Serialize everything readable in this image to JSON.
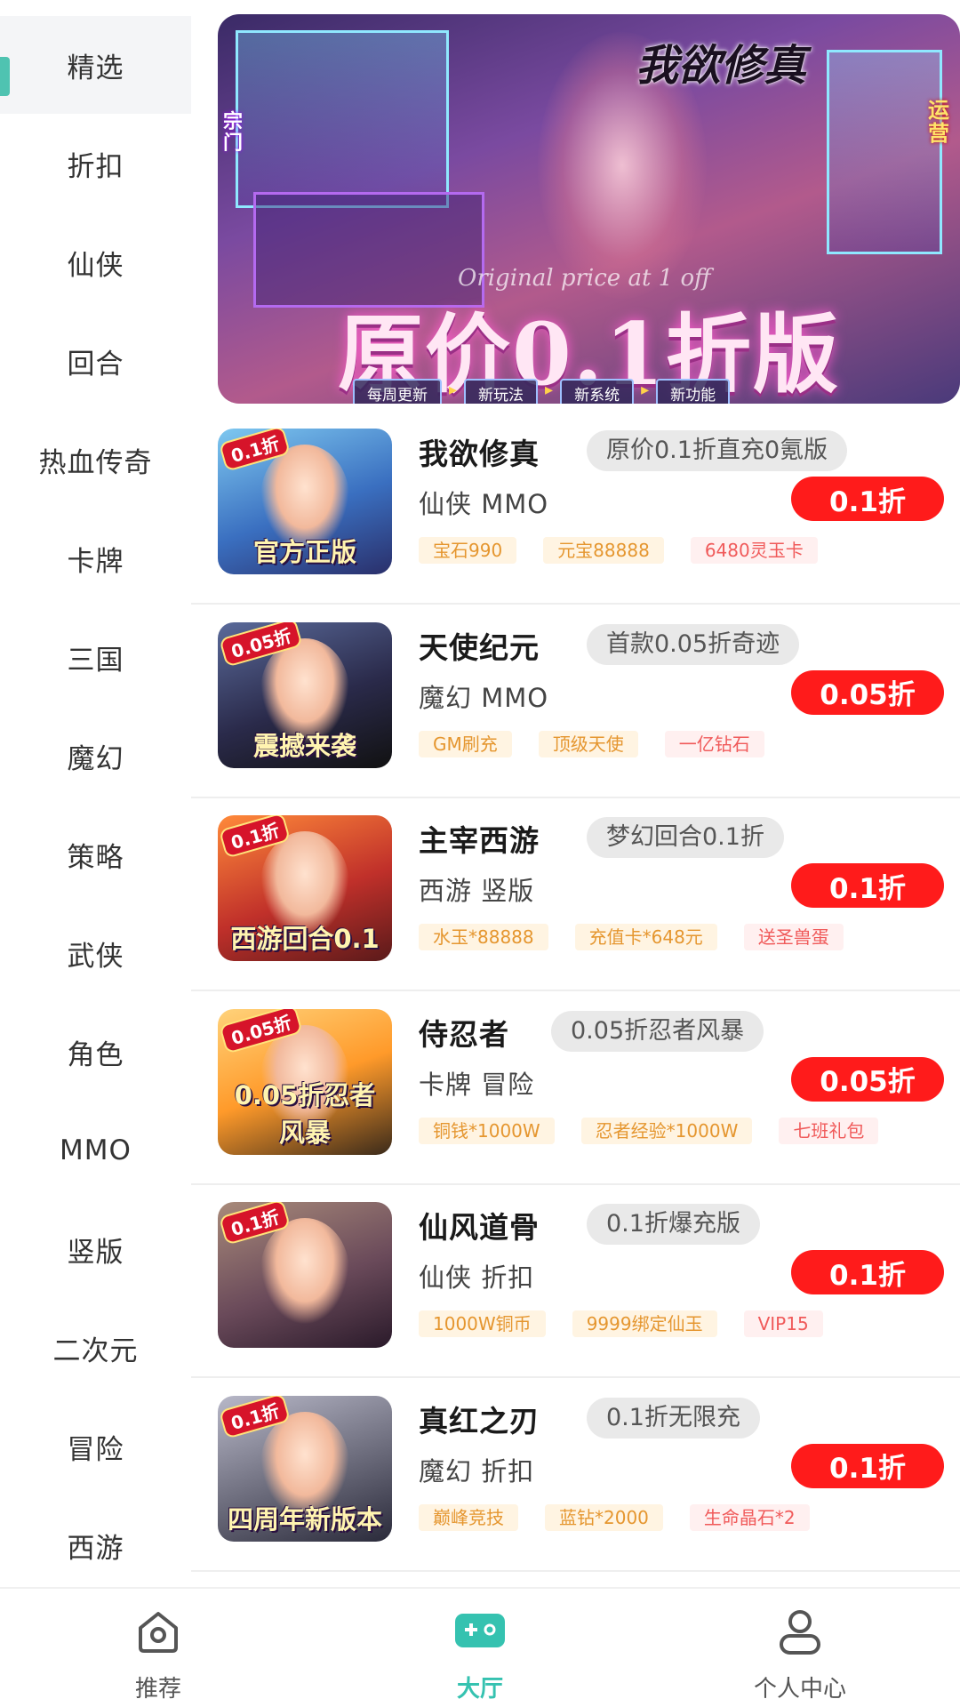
{
  "colors": {
    "accent": "#4fc3b1",
    "discount_red": "#ff1b1b",
    "tag_gold": "#e5962f",
    "tag_pink": "#f05a5a"
  },
  "sidebar": {
    "active_index": 0,
    "items": [
      "精选",
      "折扣",
      "仙侠",
      "回合",
      "热血传奇",
      "卡牌",
      "三国",
      "魔幻",
      "策略",
      "武侠",
      "角色",
      "MMO",
      "竖版",
      "二次元",
      "冒险",
      "西游"
    ]
  },
  "banner": {
    "game_name": "我欲修真",
    "subtitle": "Original price at 1 off",
    "headline": "原价0.1折版",
    "chips": [
      "每周更新",
      "新玩法",
      "新系统",
      "新功能"
    ],
    "side_left": "宗门",
    "side_right": "运营"
  },
  "games": [
    {
      "title": "我欲修真",
      "promo": "原价0.1折直充0氪版",
      "genre": "仙侠 MMO",
      "discount": "0.1折",
      "icon_corner": "0.1折",
      "icon_caption": "官方正版",
      "tags": [
        {
          "text": "宝石990",
          "style": "gold"
        },
        {
          "text": "元宝88888",
          "style": "gold"
        },
        {
          "text": "6480灵玉卡",
          "style": "pink"
        }
      ]
    },
    {
      "title": "天使纪元",
      "promo": "首款0.05折奇迹",
      "genre": "魔幻 MMO",
      "discount": "0.05折",
      "icon_corner": "0.05折",
      "icon_caption": "震撼来袭",
      "tags": [
        {
          "text": "GM刷充",
          "style": "gold"
        },
        {
          "text": "顶级天使",
          "style": "gold"
        },
        {
          "text": "一亿钻石",
          "style": "pink"
        }
      ]
    },
    {
      "title": "主宰西游",
      "promo": "梦幻回合0.1折",
      "genre": "西游 竖版",
      "discount": "0.1折",
      "icon_corner": "0.1折",
      "icon_caption": "西游回合0.1",
      "tags": [
        {
          "text": "水玉*88888",
          "style": "gold"
        },
        {
          "text": "充值卡*648元",
          "style": "gold"
        },
        {
          "text": "送圣兽蛋",
          "style": "pink"
        }
      ]
    },
    {
      "title": "侍忍者",
      "promo": "0.05折忍者风暴",
      "genre": "卡牌 冒险",
      "discount": "0.05折",
      "icon_corner": "0.05折",
      "icon_caption": "0.05折忍者风暴",
      "tags": [
        {
          "text": "铜钱*1000W",
          "style": "gold"
        },
        {
          "text": "忍者经验*1000W",
          "style": "gold"
        },
        {
          "text": "七班礼包",
          "style": "pink"
        }
      ]
    },
    {
      "title": "仙风道骨",
      "promo": "0.1折爆充版",
      "genre": "仙侠 折扣",
      "discount": "0.1折",
      "icon_corner": "0.1折",
      "icon_caption": "",
      "tags": [
        {
          "text": "1000W铜币",
          "style": "gold"
        },
        {
          "text": "9999绑定仙玉",
          "style": "gold"
        },
        {
          "text": "VIP15",
          "style": "pink"
        }
      ]
    },
    {
      "title": "真红之刃",
      "promo": "0.1折无限充",
      "genre": "魔幻 折扣",
      "discount": "0.1折",
      "icon_corner": "0.1折",
      "icon_caption": "四周年新版本",
      "tags": [
        {
          "text": "巅峰竞技",
          "style": "gold"
        },
        {
          "text": "蓝钻*2000",
          "style": "gold"
        },
        {
          "text": "生命晶石*2",
          "style": "pink"
        }
      ]
    }
  ],
  "bottom_nav": [
    {
      "label": "推荐",
      "icon": "home-icon",
      "active": false
    },
    {
      "label": "大厅",
      "icon": "gamepad-icon",
      "active": true
    },
    {
      "label": "个人中心",
      "icon": "user-icon",
      "active": false
    }
  ]
}
